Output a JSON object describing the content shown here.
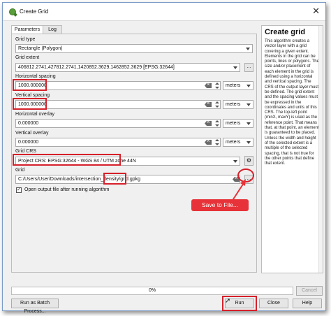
{
  "window": {
    "title": "Create Grid"
  },
  "tabs": [
    {
      "label": "Parameters",
      "active": true
    },
    {
      "label": "Log",
      "active": false
    }
  ],
  "params": {
    "grid_type": {
      "label": "Grid type",
      "value": "Rectangle (Polygon)"
    },
    "grid_extent": {
      "label": "Grid extent",
      "value": "406812.2741,427812.2741,1420852.3629,1462852.3629 [EPSG:32644]",
      "button_label": "..."
    },
    "h_spacing": {
      "label": "Horizontal spacing",
      "value": "1000.000000",
      "unit": "meters"
    },
    "v_spacing": {
      "label": "Vertical spacing",
      "value": "1000.000000",
      "unit": "meters"
    },
    "h_overlay": {
      "label": "Horizontal overlay",
      "value": "0.000000",
      "unit": "meters"
    },
    "v_overlay": {
      "label": "Vertical overlay",
      "value": "0.000000",
      "unit": "meters"
    },
    "grid_crs": {
      "label": "Grid CRS",
      "value": "Project CRS: EPSG:32644 - WGS 84 / UTM zone 44N"
    },
    "grid": {
      "label": "Grid",
      "path": "C:/Users/User/Downloads/intersection_density/grid.gpkg",
      "button_label": "..."
    },
    "open_output": {
      "label": "Open output file after running algorithm",
      "checked": true
    }
  },
  "help": {
    "title": "Create grid",
    "body": "This algorithm creates a vector layer with a grid covering a given extent. Elements in the grid can be points, lines or polygons. The size and/or placement of each element in the grid is defined using a horizontal and vertical spacing. The CRS of the output layer must be defined. The grid extent and the spacing values must be expressed in the coordinates and units of this CRS. The top-left point (minX, maxY) is used as the reference point. That means that, at that point, an element is guaranteed to be placed. Unless the width and height of the selected extent is a multiple of the selected spacing, that is not true for the other points that define that extent."
  },
  "progress": {
    "value": 0,
    "label": "0%"
  },
  "buttons": {
    "cancel": "Cancel",
    "batch": "Run as Batch Process...",
    "run": "Run",
    "close": "Close",
    "help": "Help"
  },
  "annotation": {
    "text": "Save to File..."
  },
  "colors": {
    "highlight_red": "#d6202a",
    "annotation_bg": "#e63238",
    "qgis_green": "#5a9e3c"
  }
}
